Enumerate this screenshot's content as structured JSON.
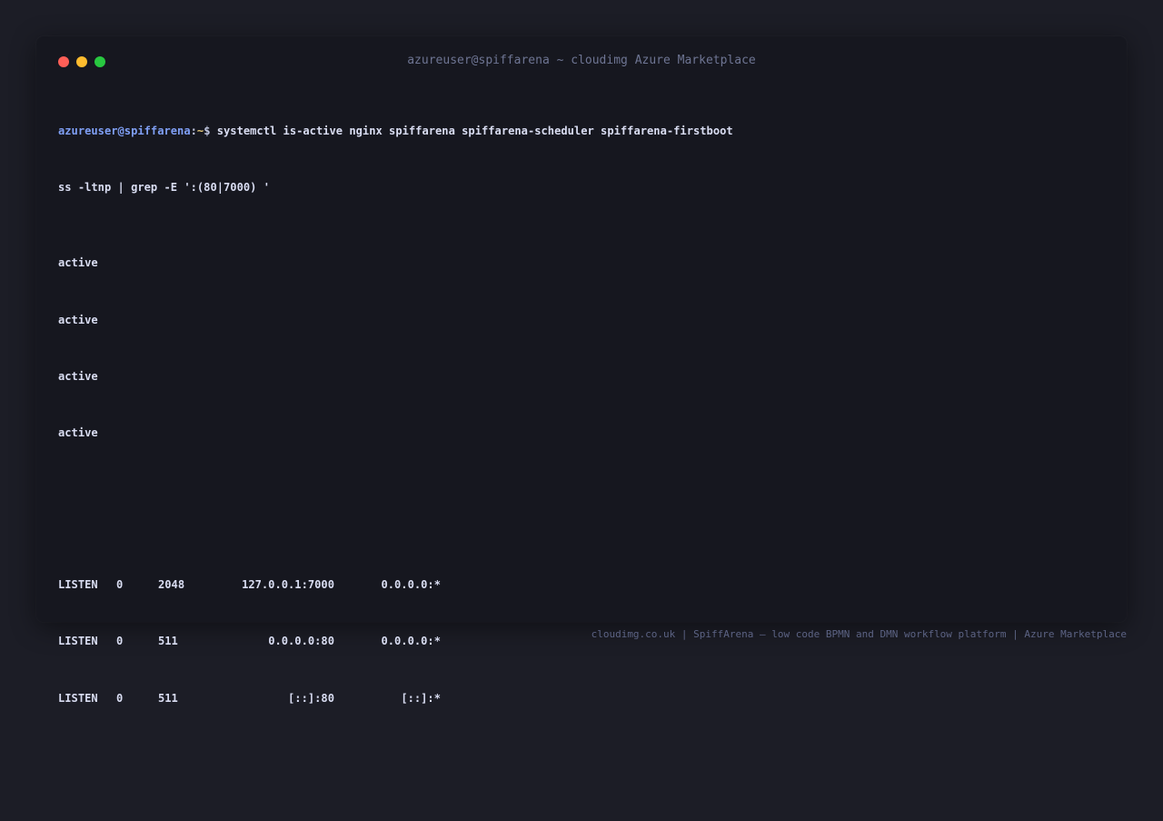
{
  "window": {
    "title": "azureuser@spiffarena ~ cloudimg Azure Marketplace"
  },
  "terminal": {
    "prompt": {
      "user_host": "azureuser@spiffarena",
      "separator": ":",
      "path": "~",
      "sign": "$ "
    },
    "command_line_1": "systemctl is-active nginx spiffarena spiffarena-scheduler spiffarena-firstboot",
    "command_line_2": "ss -ltnp | grep -E ':(80|7000) '",
    "status_lines": [
      "active",
      "active",
      "active",
      "active"
    ],
    "listen_rows": [
      {
        "state": "LISTEN",
        "recvq": "0",
        "sendq": "2048",
        "local": "127.0.0.1:7000",
        "peer": "0.0.0.0:*"
      },
      {
        "state": "LISTEN",
        "recvq": "0",
        "sendq": "511",
        "local": "0.0.0.0:80",
        "peer": "0.0.0.0:*"
      },
      {
        "state": "LISTEN",
        "recvq": "0",
        "sendq": "511",
        "local": "[::]:80",
        "peer": "[::]:*"
      }
    ]
  },
  "footer": {
    "text": "cloudimg.co.uk | SpiffArena — low code BPMN and DMN workflow platform | Azure Marketplace"
  },
  "colors": {
    "background": "#1c1d26",
    "window_bg": "#16171f",
    "prompt_user": "#7f9ff5",
    "prompt_path": "#e3c77a",
    "text": "#d9ddf2",
    "dot_close": "#ff5f57",
    "dot_minimize": "#febc2e",
    "dot_maximize": "#28c840"
  }
}
